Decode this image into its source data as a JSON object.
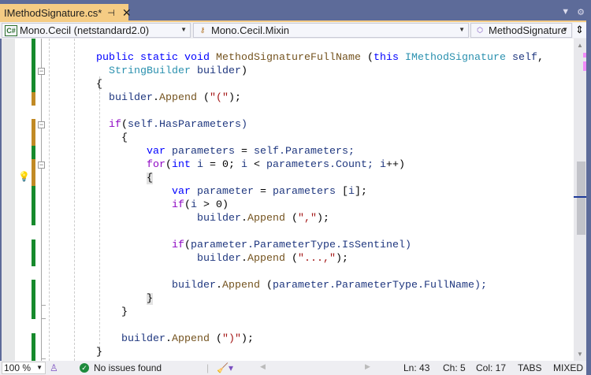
{
  "tab": {
    "title": "IMethodSignature.cs*",
    "pin_icon": "pin-icon",
    "close_icon": "close-icon"
  },
  "nav": {
    "project": "Mono.Cecil (netstandard2.0)",
    "type": "Mono.Cecil.Mixin",
    "member": "MethodSignature"
  },
  "code": [
    {
      "indent": 0,
      "tokens": [
        [
          "public",
          "kw"
        ],
        [
          " ",
          "pu"
        ],
        [
          "static",
          "kw"
        ],
        [
          " ",
          "pu"
        ],
        [
          "void",
          "kw"
        ],
        [
          " ",
          "pu"
        ],
        [
          "MethodSignatureFullName",
          "fn"
        ],
        [
          " (",
          "pu"
        ],
        [
          "this",
          "kw"
        ],
        [
          " ",
          "pu"
        ],
        [
          "IMethodSignature",
          "ty"
        ],
        [
          " ",
          "pu"
        ],
        [
          "self",
          "id"
        ],
        [
          ",",
          "pu"
        ]
      ]
    },
    {
      "indent": 2,
      "tokens": [
        [
          "StringBuilder",
          "ty"
        ],
        [
          " ",
          "pu"
        ],
        [
          "builder",
          "id"
        ],
        [
          ")",
          "pu"
        ]
      ]
    },
    {
      "indent": 0,
      "tokens": [
        [
          "{",
          "pu"
        ]
      ]
    },
    {
      "indent": 2,
      "tokens": [
        [
          "builder",
          "id"
        ],
        [
          ".",
          "pu"
        ],
        [
          "Append",
          "fn"
        ],
        [
          " (",
          "pu"
        ],
        [
          "\"(\"",
          "str"
        ],
        [
          ");",
          "pu"
        ]
      ]
    },
    {
      "indent": 0,
      "tokens": []
    },
    {
      "indent": 2,
      "tokens": [
        [
          "if",
          "ctl"
        ],
        [
          "(",
          "pu"
        ],
        [
          "self",
          "id"
        ],
        [
          ".HasParameters)",
          "id"
        ]
      ]
    },
    {
      "indent": 4,
      "tokens": [
        [
          "{",
          "pu"
        ]
      ]
    },
    {
      "indent": 8,
      "tokens": [
        [
          "var",
          "kw"
        ],
        [
          " ",
          "pu"
        ],
        [
          "parameters",
          "id"
        ],
        [
          " = ",
          "pu"
        ],
        [
          "self",
          "id"
        ],
        [
          ".Parameters;",
          "id"
        ]
      ]
    },
    {
      "indent": 8,
      "tokens": [
        [
          "for",
          "ctl"
        ],
        [
          "(",
          "pu"
        ],
        [
          "int",
          "kw"
        ],
        [
          " ",
          "pu"
        ],
        [
          "i",
          "id"
        ],
        [
          " = 0; ",
          "pu"
        ],
        [
          "i",
          "id"
        ],
        [
          " < ",
          "pu"
        ],
        [
          "parameters",
          "id"
        ],
        [
          ".Count; ",
          "id"
        ],
        [
          "i",
          "id"
        ],
        [
          "++)",
          "pu"
        ]
      ]
    },
    {
      "indent": 8,
      "hl": true,
      "tokens": [
        [
          "{",
          "pu"
        ]
      ]
    },
    {
      "indent": 12,
      "tokens": [
        [
          "var",
          "kw"
        ],
        [
          " ",
          "pu"
        ],
        [
          "parameter",
          "id"
        ],
        [
          " = ",
          "pu"
        ],
        [
          "parameters",
          "id"
        ],
        [
          " [",
          "pu"
        ],
        [
          "i",
          "id"
        ],
        [
          "];",
          "pu"
        ]
      ]
    },
    {
      "indent": 12,
      "tokens": [
        [
          "if",
          "ctl"
        ],
        [
          "(",
          "pu"
        ],
        [
          "i",
          "id"
        ],
        [
          " > 0)",
          "pu"
        ]
      ]
    },
    {
      "indent": 16,
      "tokens": [
        [
          "builder",
          "id"
        ],
        [
          ".",
          "pu"
        ],
        [
          "Append",
          "fn"
        ],
        [
          " (",
          "pu"
        ],
        [
          "\",\"",
          "str"
        ],
        [
          ");",
          "pu"
        ]
      ]
    },
    {
      "indent": 0,
      "tokens": []
    },
    {
      "indent": 12,
      "tokens": [
        [
          "if",
          "ctl"
        ],
        [
          "(",
          "pu"
        ],
        [
          "parameter",
          "id"
        ],
        [
          ".ParameterType.IsSentinel)",
          "id"
        ]
      ]
    },
    {
      "indent": 16,
      "tokens": [
        [
          "builder",
          "id"
        ],
        [
          ".",
          "pu"
        ],
        [
          "Append",
          "fn"
        ],
        [
          " (",
          "pu"
        ],
        [
          "\"...,\"",
          "str"
        ],
        [
          ");",
          "pu"
        ]
      ]
    },
    {
      "indent": 0,
      "tokens": []
    },
    {
      "indent": 12,
      "tokens": [
        [
          "builder",
          "id"
        ],
        [
          ".",
          "pu"
        ],
        [
          "Append",
          "fn"
        ],
        [
          " (",
          "pu"
        ],
        [
          "parameter",
          "id"
        ],
        [
          ".ParameterType.FullName);",
          "id"
        ]
      ]
    },
    {
      "indent": 8,
      "hl": true,
      "tokens": [
        [
          "}",
          "pu"
        ]
      ]
    },
    {
      "indent": 4,
      "tokens": [
        [
          "}",
          "pu"
        ]
      ]
    },
    {
      "indent": 0,
      "tokens": []
    },
    {
      "indent": 4,
      "tokens": [
        [
          "builder",
          "id"
        ],
        [
          ".",
          "pu"
        ],
        [
          "Append",
          "fn"
        ],
        [
          " (",
          "pu"
        ],
        [
          "\")\"",
          "str"
        ],
        [
          ");",
          "pu"
        ]
      ]
    },
    {
      "indent": 0,
      "tokens": [
        [
          "}",
          "pu"
        ]
      ]
    }
  ],
  "status": {
    "zoom": "100 %",
    "issues": "No issues found",
    "ln": "Ln: 43",
    "ch": "Ch: 5",
    "col": "Col: 17",
    "tabs": "TABS",
    "eol": "MIXED"
  },
  "colors": {
    "tab": "#f5cc84",
    "frame": "#5d6b99",
    "added": "#168a2c",
    "modified": "#c18a25",
    "check": "#1e8a3c"
  }
}
